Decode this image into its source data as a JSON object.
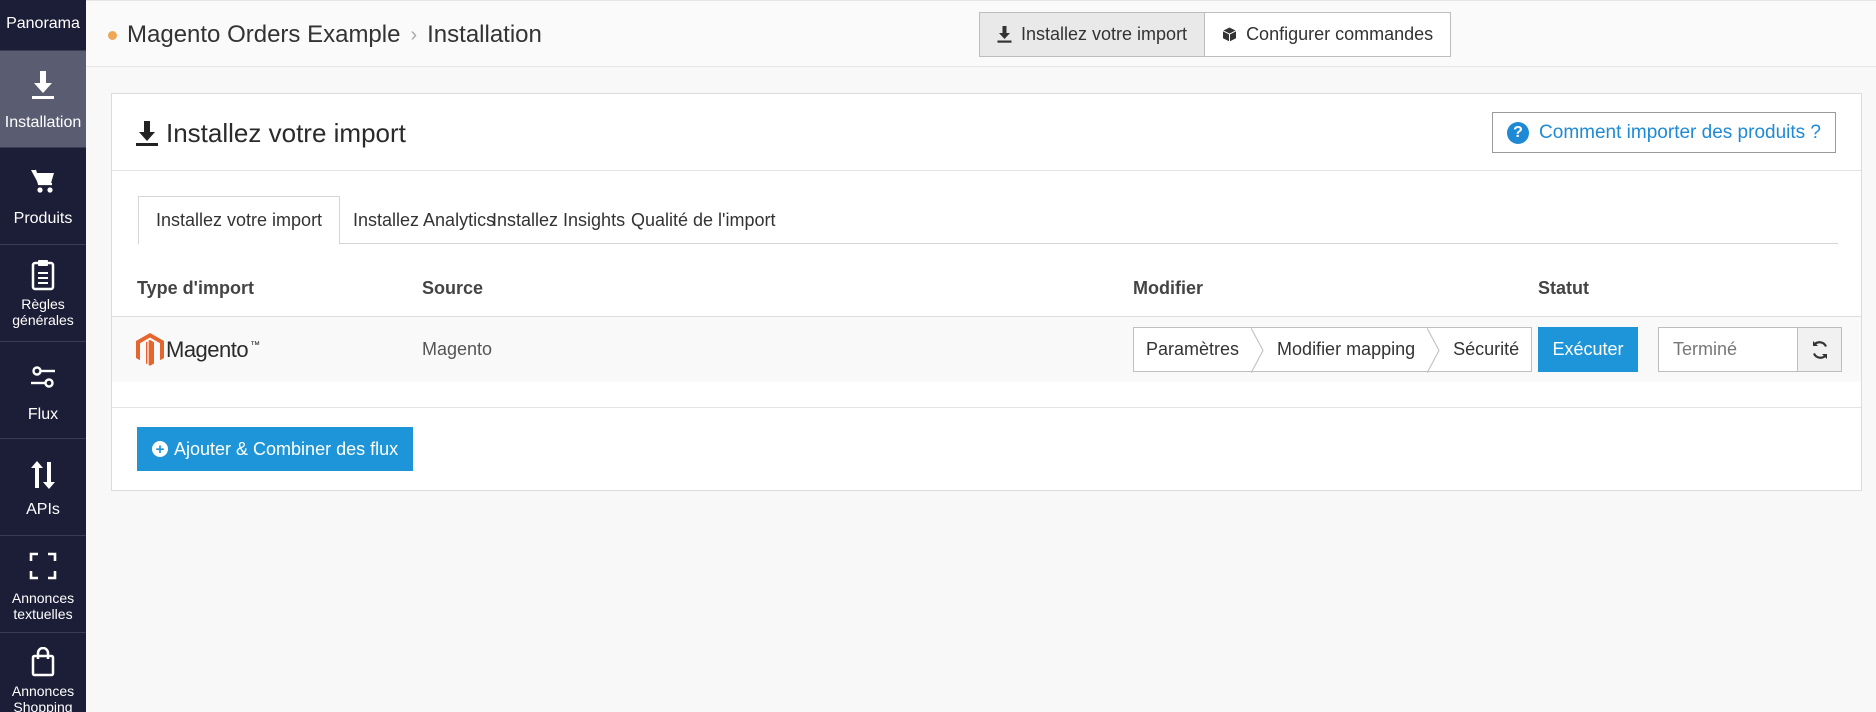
{
  "sidebar": {
    "items": [
      {
        "label": "Panorama",
        "icon": "dashboard-icon"
      },
      {
        "label": "Installation",
        "icon": "download-icon"
      },
      {
        "label": "Produits",
        "icon": "cart-icon"
      },
      {
        "label": "Règles générales",
        "icon": "clipboard-icon"
      },
      {
        "label": "Flux",
        "icon": "sliders-icon"
      },
      {
        "label": "APIs",
        "icon": "arrows-updown-icon"
      },
      {
        "label": "Annonces textuelles",
        "icon": "expand-icon"
      },
      {
        "label": "Annonces Shopping",
        "icon": "shopping-bag-icon"
      }
    ]
  },
  "breadcrumb": {
    "project": "Magento Orders Example",
    "page": "Installation"
  },
  "top_buttons": {
    "install_import": "Installez votre import",
    "configure_orders": "Configurer commandes"
  },
  "panel": {
    "title": "Installez votre import",
    "help": "Comment importer des produits ?",
    "tabs": [
      "Installez votre import",
      "Installez Analytics",
      "Installez Insights",
      "Qualité de l'import"
    ],
    "columns": {
      "type": "Type d'import",
      "source": "Source",
      "modify": "Modifier",
      "status": "Statut"
    },
    "row": {
      "logo_text": "Magento",
      "logo_suffix": "™",
      "source": "Magento",
      "steps": [
        "Paramètres",
        "Modifier mapping",
        "Sécurité"
      ],
      "run": "Exécuter",
      "status": "Terminé"
    },
    "add_button": "Ajouter & Combiner des flux"
  },
  "colors": {
    "sidebar_bg": "#1c1d36",
    "sidebar_active": "#5a5d72",
    "accent": "#1e95d8",
    "link": "#1e8ad6",
    "breadcrumb_dot": "#f0a755",
    "magento_orange": "#e5652e"
  }
}
